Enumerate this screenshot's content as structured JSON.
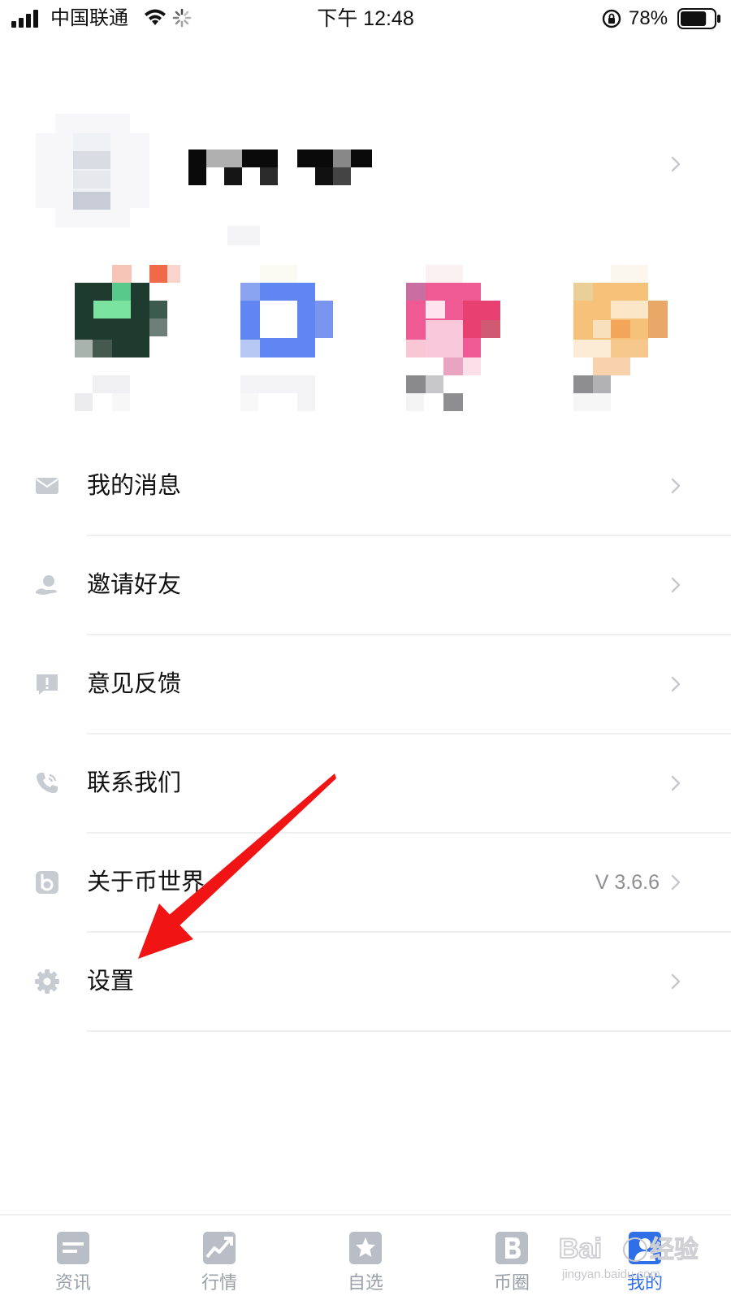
{
  "status_bar": {
    "carrier": "中国联通",
    "time": "下午 12:48",
    "battery_percent": "78%",
    "battery_level": 0.78,
    "icons": [
      "signal-icon",
      "wifi-icon",
      "loading-icon",
      "orientation-lock-icon",
      "battery-icon"
    ]
  },
  "profile": {
    "avatar": "avatar (pixelated)",
    "username_redacted": true
  },
  "shortcuts": [
    {
      "name": "shortcut-1",
      "redacted": true
    },
    {
      "name": "shortcut-2",
      "redacted": true
    },
    {
      "name": "shortcut-3",
      "redacted": true
    },
    {
      "name": "shortcut-4",
      "redacted": true
    }
  ],
  "menu": {
    "items": [
      {
        "label": "我的消息",
        "icon": "mail-icon",
        "value": ""
      },
      {
        "label": "邀请好友",
        "icon": "invite-icon",
        "value": ""
      },
      {
        "label": "意见反馈",
        "icon": "feedback-icon",
        "value": ""
      },
      {
        "label": "联系我们",
        "icon": "phone-icon",
        "value": ""
      },
      {
        "label": "关于币世界",
        "icon": "about-icon",
        "value": "V 3.6.6"
      },
      {
        "label": "设置",
        "icon": "gear-icon",
        "value": ""
      }
    ]
  },
  "tab_bar": {
    "tabs": [
      {
        "label": "资讯",
        "icon": "news-icon",
        "active": false
      },
      {
        "label": "行情",
        "icon": "market-icon",
        "active": false
      },
      {
        "label": "自选",
        "icon": "star-icon",
        "active": false
      },
      {
        "label": "币圈",
        "icon": "b-icon",
        "active": false
      },
      {
        "label": "我的",
        "icon": "profile-icon",
        "active": true
      }
    ]
  },
  "watermark": {
    "text": "jingyan.baidu.com"
  },
  "colors": {
    "accent": "#2f6fe8",
    "icon_gray": "#c7ccd3",
    "annotation_red": "#f01414",
    "divider": "#f0f0f2"
  }
}
